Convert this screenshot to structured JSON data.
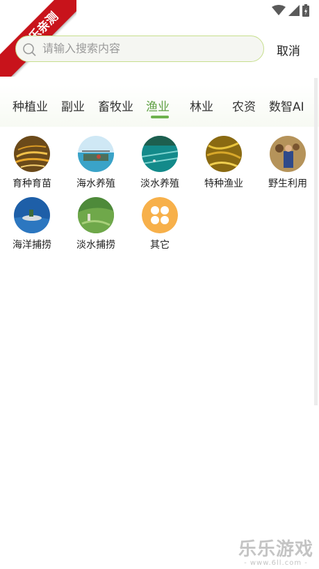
{
  "ribbon": {
    "text": "乐乐亲测"
  },
  "search": {
    "placeholder": "请输入搜索内容",
    "cancel_label": "取消"
  },
  "tabs": [
    {
      "label": "种植业"
    },
    {
      "label": "副业"
    },
    {
      "label": "畜牧业"
    },
    {
      "label": "渔业",
      "active": true
    },
    {
      "label": "林业"
    },
    {
      "label": "农资"
    },
    {
      "label": "数智AI"
    }
  ],
  "categories": [
    {
      "label": "育种育苗",
      "icon": "fish-fry-photo"
    },
    {
      "label": "海水养殖",
      "icon": "sea-farm-photo"
    },
    {
      "label": "淡水养殖",
      "icon": "fish-pond-photo"
    },
    {
      "label": "特种渔业",
      "icon": "eel-photo"
    },
    {
      "label": "野生利用",
      "icon": "wild-catch-photo"
    },
    {
      "label": "海洋捕捞",
      "icon": "sea-fishing-photo"
    },
    {
      "label": "淡水捕捞",
      "icon": "lake-fishing-photo"
    },
    {
      "label": "其它",
      "icon": "grid-four-dots-icon"
    }
  ],
  "watermark": {
    "title": "乐乐游戏",
    "url": "- www.6ll.com -"
  },
  "colors": {
    "accent": "#6fb24f",
    "ribbon": "#c8131b"
  }
}
